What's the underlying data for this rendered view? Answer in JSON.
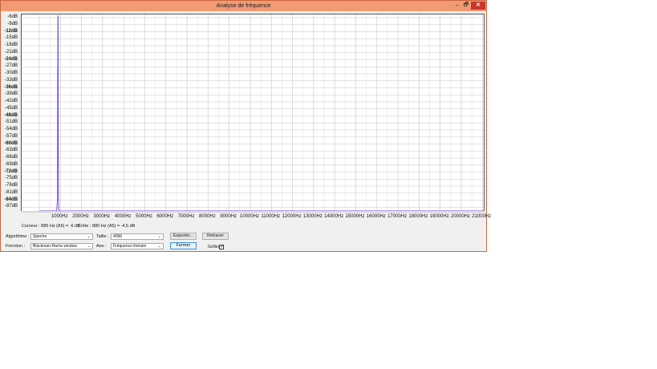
{
  "window": {
    "title": "Analyse de fréquence"
  },
  "titlebar_buttons": {
    "minimize": "–",
    "maximize": "🗗",
    "close": "✕"
  },
  "chart_data": {
    "type": "line",
    "title": "",
    "xlabel": "",
    "ylabel": "",
    "xlim": [
      0,
      22000
    ],
    "ylim": [
      -92,
      -5
    ],
    "grid": true,
    "y_ticks": [
      "-6dB",
      "-9dB",
      "-12dB",
      "-15dB",
      "-18dB",
      "-21dB",
      "-24dB",
      "-27dB",
      "-30dB",
      "-33dB",
      "-36dB",
      "-39dB",
      "-42dB",
      "-45dB",
      "-48dB",
      "-51dB",
      "-54dB",
      "-57dB",
      "-60dB",
      "-63dB",
      "-66dB",
      "-69dB",
      "-72dB",
      "-75dB",
      "-78dB",
      "-81dB",
      "-84dB",
      "-87dB"
    ],
    "y_tick_values": [
      -6,
      -9,
      -12,
      -15,
      -18,
      -21,
      -24,
      -27,
      -30,
      -33,
      -36,
      -39,
      -42,
      -45,
      -48,
      -51,
      -54,
      -57,
      -60,
      -63,
      -66,
      -69,
      -72,
      -75,
      -78,
      -81,
      -84,
      -87
    ],
    "bold_y_ticks": [
      "-12dB",
      "-24dB",
      "-36dB",
      "-48dB",
      "-60dB",
      "-72dB",
      "-84dB"
    ],
    "x_ticks": [
      "1000Hz",
      "2000Hz",
      "3000Hz",
      "4000Hz",
      "5000Hz",
      "6000Hz",
      "7000Hz",
      "8000Hz",
      "9000Hz",
      "10000Hz",
      "11000Hz",
      "12000Hz",
      "13000Hz",
      "14000Hz",
      "15000Hz",
      "16000Hz",
      "17000Hz",
      "18000Hz",
      "19000Hz",
      "20000Hz",
      "21000Hz"
    ],
    "x_tick_values": [
      1000,
      2000,
      3000,
      4000,
      5000,
      6000,
      7000,
      8000,
      9000,
      10000,
      11000,
      12000,
      13000,
      14000,
      15000,
      16000,
      17000,
      18000,
      19000,
      20000,
      21000
    ],
    "series": [
      {
        "color": "#7b4bd6",
        "x": [
          0,
          700,
          820,
          860,
          870,
          875,
          880,
          885,
          890,
          895,
          900,
          910,
          930,
          960,
          1000,
          1100,
          22000
        ],
        "y": [
          -92,
          -92,
          -92,
          -84,
          -30,
          -27,
          -7,
          -5,
          -6,
          -27,
          -60,
          -84,
          -90,
          -92,
          -92,
          -92,
          -92
        ]
      }
    ]
  },
  "info": {
    "cursor": "Curseur : 885 Hz (A5) = -6 dB",
    "peak": "Crête : 880 Hz (A5) = -4,5 dB"
  },
  "controls": {
    "algorithm_label": "Algorithme :",
    "algorithm_value": "Spectre",
    "size_label": "Taille :",
    "size_value": "4096",
    "export_label": "Exporter...",
    "replot_label": "Retracer",
    "function_label": "Fonction :",
    "function_value": "Blackman-Harris window",
    "axis_label": "Axe :",
    "axis_value": "Fréquence linéaire",
    "close_label": "Fermer",
    "grids_label": "Grilles",
    "grids_checked": "✓",
    "dropdown_arrow": "⌄"
  }
}
